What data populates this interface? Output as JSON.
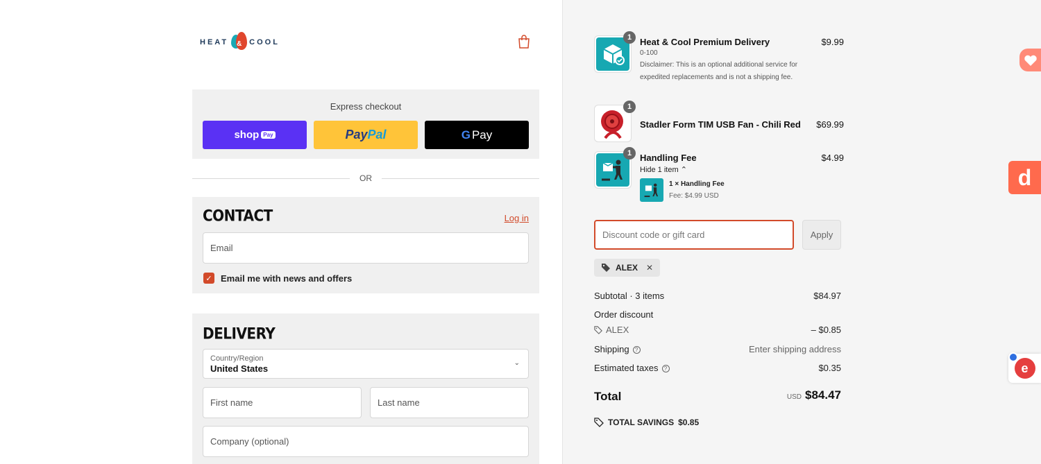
{
  "brand": {
    "logo_left": "HEAT",
    "logo_amp": "&",
    "logo_right": "COOL",
    "accent": "#d24a2a"
  },
  "express": {
    "title": "Express checkout",
    "shoppay_label": "shop",
    "shoppay_badge": "Pay",
    "paypal_a": "Pay",
    "paypal_b": "Pal",
    "gpay_g": "G",
    "gpay_label": "Pay",
    "or_label": "OR"
  },
  "contact": {
    "title": "CONTACT",
    "login_label": "Log in",
    "email_placeholder": "Email",
    "newsletter_label": "Email me with news and offers",
    "newsletter_checked": true
  },
  "delivery": {
    "title": "DELIVERY",
    "country_label": "Country/Region",
    "country_value": "United States",
    "first_name_placeholder": "First name",
    "last_name_placeholder": "Last name",
    "company_placeholder": "Company (optional)"
  },
  "order": {
    "items": [
      {
        "name": "Heat & Cool Premium Delivery",
        "price": "$9.99",
        "qty": "1",
        "variant": "0-100",
        "disclaimer": "Disclaimer: This is an optional additional service for expedited replacements and is not a shipping fee.",
        "icon": "package-check-icon"
      },
      {
        "name": "Stadler Form TIM USB Fan - Chili Red",
        "price": "$69.99",
        "qty": "1",
        "icon": "fan-product-image"
      },
      {
        "name": "Handling Fee",
        "price": "$4.99",
        "qty": "1",
        "toggle_label": "Hide 1 item",
        "sub_item_name": "1 × Handling Fee",
        "sub_item_fee": "Fee: $4.99 USD",
        "icon": "handling-icon"
      }
    ],
    "discount_placeholder": "Discount code or gift card",
    "apply_label": "Apply",
    "applied_code": "ALEX",
    "subtotal_label": "Subtotal",
    "subtotal_items": "3 items",
    "subtotal_value": "$84.97",
    "order_discount_label": "Order discount",
    "discount_code_label": "ALEX",
    "discount_value": "– $0.85",
    "shipping_label": "Shipping",
    "shipping_value": "Enter shipping address",
    "taxes_label": "Estimated taxes",
    "taxes_value": "$0.35",
    "total_label": "Total",
    "total_currency": "USD",
    "total_value": "$84.47",
    "savings_label": "TOTAL SAVINGS",
    "savings_value": "$0.85"
  },
  "widgets": {
    "float2_letter": "d",
    "float3_letter": "e"
  }
}
